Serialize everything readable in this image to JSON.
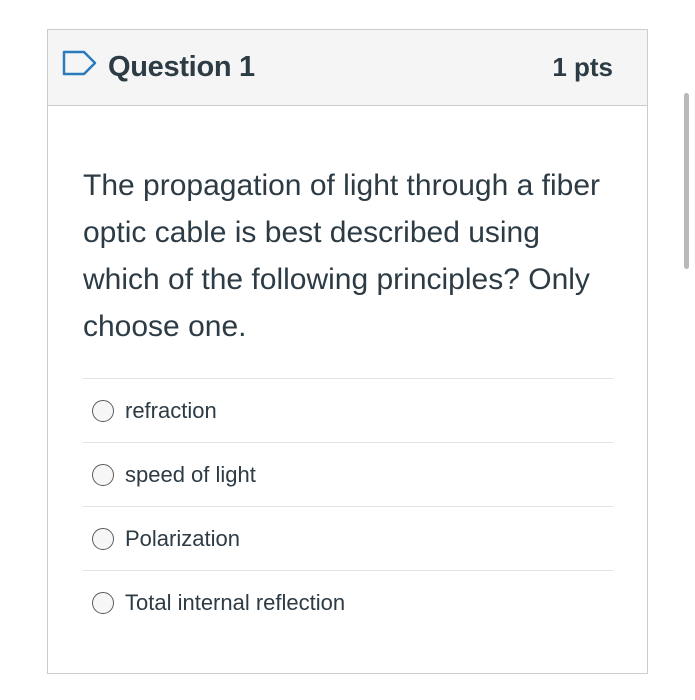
{
  "question": {
    "title": "Question 1",
    "points": "1 pts",
    "text": "The propagation of light through a fiber optic cable is best described using which of the following principles? Only choose one.",
    "flag_icon": "flag-question-icon",
    "answers": [
      {
        "label": "refraction",
        "selected": false
      },
      {
        "label": "speed of light",
        "selected": false
      },
      {
        "label": "Polarization",
        "selected": false
      },
      {
        "label": "Total internal reflection",
        "selected": false
      }
    ]
  },
  "colors": {
    "text": "#2d3b45",
    "header_bg": "#f5f5f5",
    "border": "#c7cdd1",
    "flag_blue": "#2b7abc"
  }
}
